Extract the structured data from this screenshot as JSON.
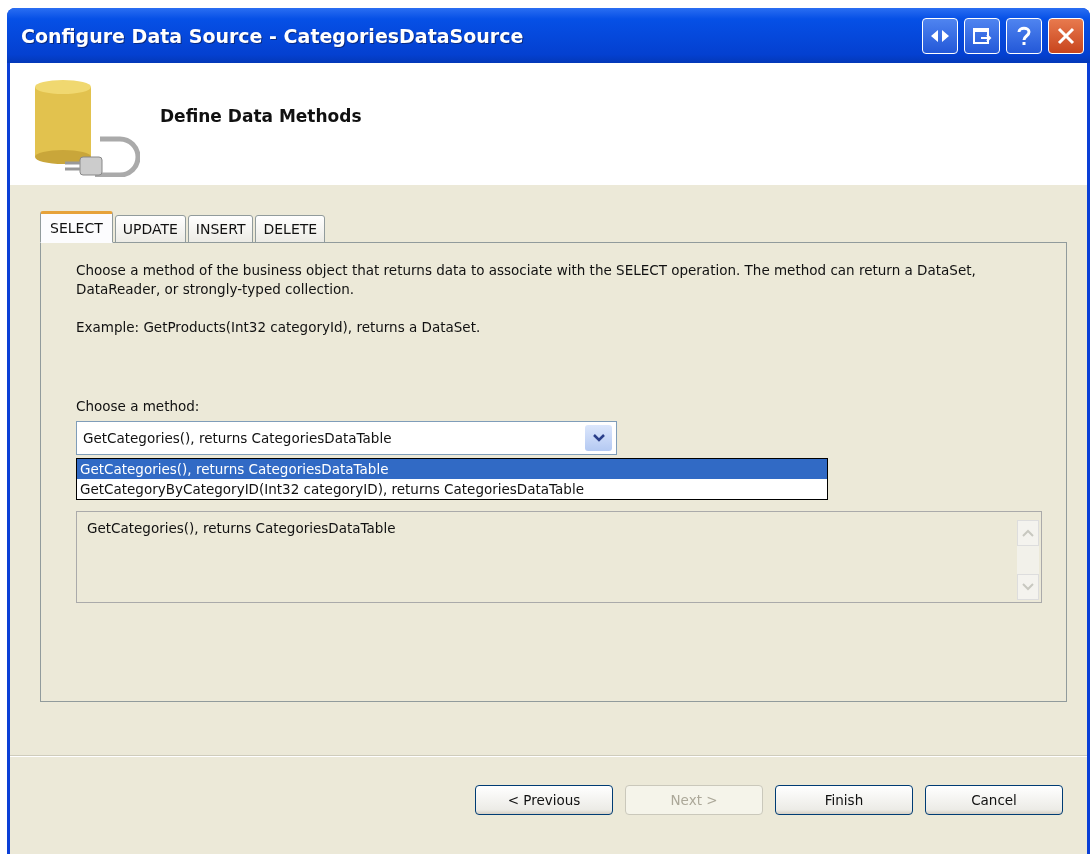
{
  "window": {
    "title": "Configure Data Source - CategoriesDataSource"
  },
  "header": {
    "title": "Define Data Methods"
  },
  "tabs": [
    {
      "label": "SELECT",
      "selected": true
    },
    {
      "label": "UPDATE",
      "selected": false
    },
    {
      "label": "INSERT",
      "selected": false
    },
    {
      "label": "DELETE",
      "selected": false
    }
  ],
  "description": "Choose a method of the business object that returns data to associate with the SELECT operation. The method can return a DataSet, DataReader, or strongly-typed collection.",
  "example": "Example: GetProducts(Int32 categoryId), returns a DataSet.",
  "method_label": "Choose a method:",
  "method_combo": {
    "value": "GetCategories(), returns CategoriesDataTable",
    "expanded": true
  },
  "method_options": [
    {
      "label": "GetCategories(), returns CategoriesDataTable",
      "selected": true
    },
    {
      "label": "GetCategoryByCategoryID(Int32 categoryID), returns CategoriesDataTable",
      "selected": false
    }
  ],
  "method_signature": "GetCategories(), returns CategoriesDataTable",
  "buttons": [
    {
      "label": "< Previous",
      "disabled": false
    },
    {
      "label": "Next >",
      "disabled": true
    },
    {
      "label": "Finish",
      "disabled": false
    },
    {
      "label": "Cancel",
      "disabled": false
    }
  ]
}
